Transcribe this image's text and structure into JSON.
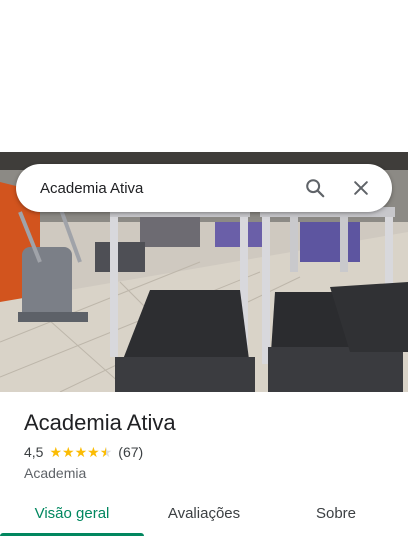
{
  "search": {
    "query": "Academia Ativa"
  },
  "place": {
    "name": "Academia Ativa",
    "rating": "4,5",
    "rating_value": 4.5,
    "review_count": "(67)",
    "category": "Academia"
  },
  "tabs": [
    {
      "label": "Visão geral",
      "active": true
    },
    {
      "label": "Avaliações",
      "active": false
    },
    {
      "label": "Sobre",
      "active": false
    }
  ],
  "colors": {
    "accent": "#01875f",
    "star": "#fbbc04",
    "text": "#202124",
    "secondary_text": "#5f6368"
  },
  "icons": [
    "search-icon",
    "close-icon",
    "star-icon"
  ]
}
